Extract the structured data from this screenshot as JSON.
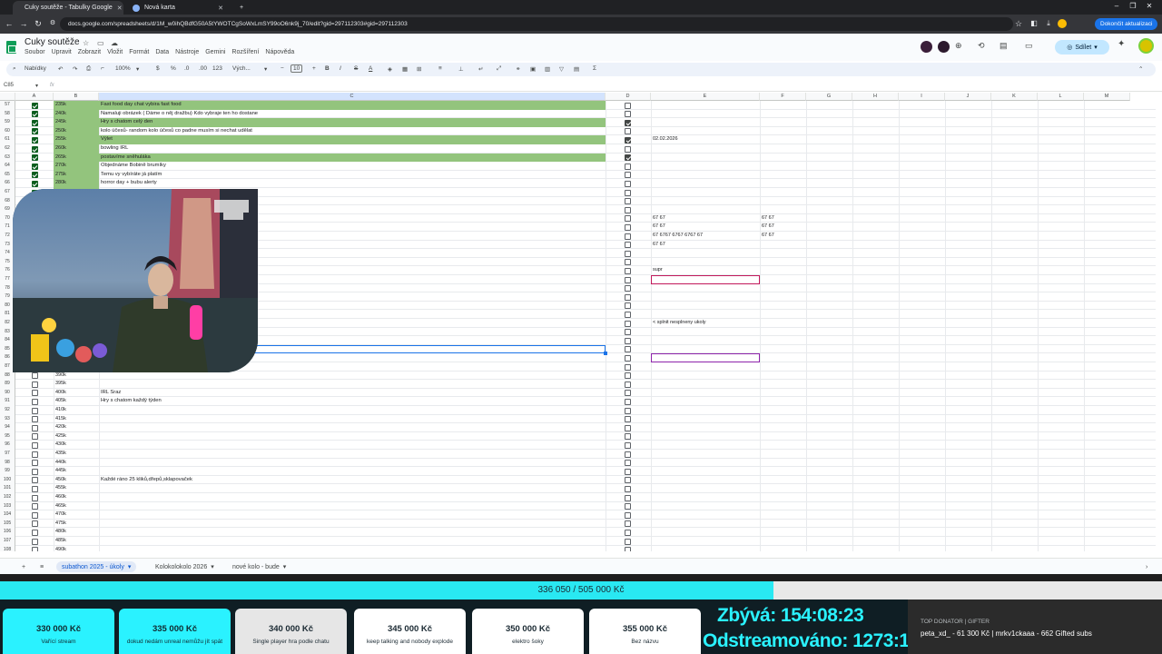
{
  "browser": {
    "tabs": [
      {
        "label": "Cuky soutěže - Tabulky Google",
        "active": true
      },
      {
        "label": "Nová karta",
        "active": false
      }
    ],
    "new_tab": "+",
    "url": "docs.google.com/spreadsheets/d/1M_w0ihQBdfG50A5tYWOTCgSoWxLmSY99oO6nk9j_70/edit?gid=297112303#gid=297112303",
    "update_button": "Dokončit aktualizaci"
  },
  "doc": {
    "title": "Cuky soutěže",
    "menu": [
      "Soubor",
      "Upravit",
      "Zobrazit",
      "Vložit",
      "Formát",
      "Data",
      "Nástroje",
      "Gemini",
      "Rozšíření",
      "Nápověda"
    ],
    "share_label": "Sdílet"
  },
  "toolbar": {
    "menus": "Nabídky",
    "zoom": "100%",
    "currency": "$",
    "percent": "%",
    "dec_less": ".0",
    "dec_more": ".00",
    "num_format": "123",
    "font": "Vých...",
    "font_size": "10",
    "bold": "B",
    "italic": "I",
    "strike": "S",
    "text_color": "A"
  },
  "formula_bar": {
    "cell_ref": "C85",
    "fx": "fx"
  },
  "columns": [
    "A",
    "B",
    "C",
    "D",
    "E",
    "F",
    "G",
    "H",
    "I",
    "J",
    "K",
    "L",
    "M"
  ],
  "rows": [
    {
      "n": "57",
      "a": true,
      "b": "235k",
      "c": "Fast food day chat vybira fast food",
      "d": false,
      "g": true
    },
    {
      "n": "58",
      "a": true,
      "b": "240k",
      "c": "Namaluji obrázek ( Dáme o něj dražbu) Kdo vybraje ten ho dostane",
      "d": false,
      "g": false
    },
    {
      "n": "59",
      "a": true,
      "b": "245k",
      "c": "Hry s chatom celý den",
      "d": true,
      "g": true
    },
    {
      "n": "60",
      "a": true,
      "b": "250k",
      "c": "kolo účesů- random kolo účesů co padne musím si nechat udělat",
      "d": false,
      "g": false
    },
    {
      "n": "61",
      "a": true,
      "b": "255k",
      "c": "Výlet",
      "d": true,
      "g": true,
      "e": "02.02.2026"
    },
    {
      "n": "62",
      "a": true,
      "b": "260k",
      "c": "bowling IRL",
      "d": false,
      "g": false
    },
    {
      "n": "63",
      "a": true,
      "b": "265k",
      "c": "postavíme sněhuláka",
      "d": true,
      "g": true
    },
    {
      "n": "64",
      "a": true,
      "b": "270k",
      "c": "Objednáme Bobině brumíky",
      "d": false,
      "g": false
    },
    {
      "n": "65",
      "a": true,
      "b": "275k",
      "c": "Temu vy vybíráte já platím",
      "d": false,
      "g": false
    },
    {
      "n": "66",
      "a": true,
      "b": "280k",
      "c": "horror day + bubu alerty",
      "d": false,
      "g": false
    },
    {
      "n": "67",
      "a": true,
      "b": "285k",
      "c": "",
      "d": false,
      "g": false
    },
    {
      "n": "68",
      "a": true,
      "b": "",
      "c": "",
      "d": false
    },
    {
      "n": "69",
      "a": true,
      "b": "",
      "c": "",
      "d": false
    },
    {
      "n": "70",
      "a": true,
      "b": "",
      "c": "",
      "d": false,
      "e": "67 67",
      "f": "67 67"
    },
    {
      "n": "71",
      "a": true,
      "b": "",
      "c": "",
      "d": false,
      "e": "67 67",
      "f": "67 67"
    },
    {
      "n": "72",
      "a": true,
      "b": "",
      "c": "",
      "d": false,
      "e": "67 6767 6767 6767 67",
      "f": "67 67"
    },
    {
      "n": "73",
      "a": true,
      "b": "",
      "c": "",
      "d": false,
      "e": "67 67"
    },
    {
      "n": "74",
      "a": true,
      "b": "",
      "c": "",
      "d": false
    },
    {
      "n": "75",
      "a": true,
      "b": "",
      "c": "",
      "d": false
    },
    {
      "n": "76",
      "a": true,
      "b": "",
      "c": "",
      "d": false,
      "e": "supr"
    },
    {
      "n": "77",
      "a": true,
      "b": "",
      "c": "",
      "d": false,
      "boxE": "pink"
    },
    {
      "n": "78",
      "a": true,
      "b": "",
      "c": "",
      "d": false
    },
    {
      "n": "79",
      "a": true,
      "b": "",
      "c": "",
      "d": false
    },
    {
      "n": "80",
      "a": true,
      "b": "",
      "c": "",
      "d": false
    },
    {
      "n": "81",
      "a": true,
      "b": "",
      "c": "",
      "d": false
    },
    {
      "n": "82",
      "a": true,
      "b": "",
      "c": "",
      "d": false,
      "e": "< splnit nesplneny ukoly"
    },
    {
      "n": "83",
      "a": true,
      "b": "",
      "c": "",
      "d": false
    },
    {
      "n": "84",
      "a": true,
      "b": "",
      "c": "",
      "d": false
    },
    {
      "n": "85",
      "a": true,
      "b": "",
      "c": "",
      "d": false,
      "selected": true
    },
    {
      "n": "86",
      "a": true,
      "b": "",
      "c": "",
      "d": false,
      "boxE": "purple"
    },
    {
      "n": "87",
      "a": true,
      "b": "",
      "c": "",
      "d": false
    },
    {
      "n": "88",
      "a": false,
      "b": "390k",
      "c": "",
      "d": false
    },
    {
      "n": "89",
      "a": false,
      "b": "395k",
      "c": "",
      "d": false
    },
    {
      "n": "90",
      "a": false,
      "b": "400k",
      "c": "IRL Sraz",
      "d": false
    },
    {
      "n": "91",
      "a": false,
      "b": "405k",
      "c": "Hry s chatom každý týden",
      "d": false
    },
    {
      "n": "92",
      "a": false,
      "b": "410k",
      "c": "",
      "d": false
    },
    {
      "n": "93",
      "a": false,
      "b": "415k",
      "c": "",
      "d": false
    },
    {
      "n": "94",
      "a": false,
      "b": "420k",
      "c": "",
      "d": false
    },
    {
      "n": "95",
      "a": false,
      "b": "425k",
      "c": "",
      "d": false
    },
    {
      "n": "96",
      "a": false,
      "b": "430k",
      "c": "",
      "d": false
    },
    {
      "n": "97",
      "a": false,
      "b": "435k",
      "c": "",
      "d": false
    },
    {
      "n": "98",
      "a": false,
      "b": "440k",
      "c": "",
      "d": false
    },
    {
      "n": "99",
      "a": false,
      "b": "445k",
      "c": "",
      "d": false
    },
    {
      "n": "100",
      "a": false,
      "b": "450k",
      "c": "Každé ráno 25 kliků,dřepů,sklapovaček",
      "d": false
    },
    {
      "n": "101",
      "a": false,
      "b": "455k",
      "c": "",
      "d": false
    },
    {
      "n": "102",
      "a": false,
      "b": "460k",
      "c": "",
      "d": false
    },
    {
      "n": "103",
      "a": false,
      "b": "465k",
      "c": "",
      "d": false
    },
    {
      "n": "104",
      "a": false,
      "b": "470k",
      "c": "",
      "d": false
    },
    {
      "n": "105",
      "a": false,
      "b": "475k",
      "c": "",
      "d": false
    },
    {
      "n": "106",
      "a": false,
      "b": "480k",
      "c": "",
      "d": false
    },
    {
      "n": "107",
      "a": false,
      "b": "485k",
      "c": "",
      "d": false
    },
    {
      "n": "108",
      "a": false,
      "b": "490k",
      "c": "",
      "d": false
    }
  ],
  "sheet_tabs": [
    {
      "label": "subathon 2025 - úkoly",
      "active": true
    },
    {
      "label": "Kolokolokolo 2026",
      "active": false
    },
    {
      "label": "nové kolo - bude",
      "active": false
    }
  ],
  "stream": {
    "progress_text": "336 050 / 505 000 Kč",
    "progress_fraction": 0.6654,
    "goals": [
      {
        "amount": "330 000 Kč",
        "desc": "Vařící stream",
        "state": "done"
      },
      {
        "amount": "335 000 Kč",
        "desc": "dokud nedám unreal nemůžu jít spát",
        "state": "done"
      },
      {
        "amount": "340 000 Kč",
        "desc": "Single player hra podle chatu",
        "state": "next"
      },
      {
        "amount": "345 000 Kč",
        "desc": "keep talking and nobody explode",
        "state": "todo"
      },
      {
        "amount": "350 000 Kč",
        "desc": "elektro šoky",
        "state": "todo"
      },
      {
        "amount": "355 000 Kč",
        "desc": "Bez názvu",
        "state": "todo"
      }
    ],
    "remaining_label": "Zbývá:",
    "remaining_value": "154:08:23",
    "streamed_label": "Odstreamováno:",
    "streamed_value": "1273:16:35",
    "donator_header": "TOP DONATOR | GIFTER",
    "donator_text": "peta_xd_ - 61 300 Kč | mrkv1ckaaa - 662 Gifted subs"
  },
  "colors": {
    "accent_cyan": "#29e8f2",
    "done_green": "#93c47d",
    "goal_done": "#2af2ff"
  }
}
